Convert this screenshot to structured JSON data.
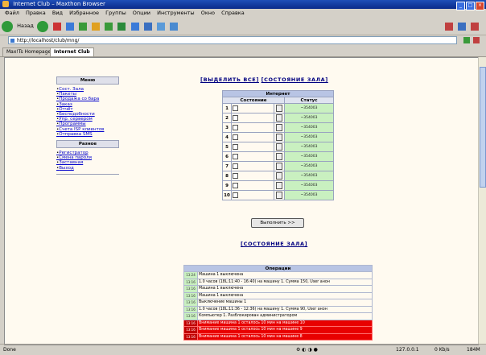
{
  "window": {
    "title": "Internet Club – Maxthon Browser"
  },
  "menu": [
    "Файл",
    "Правка",
    "Вид",
    "Избранное",
    "Группы",
    "Опции",
    "Инструменты",
    "Окно",
    "Справка"
  ],
  "toolbar": {
    "back": "Назад"
  },
  "address": {
    "url": "http://localhost/club/mng/"
  },
  "tabs": [
    {
      "label": "Max!Ts Homepage"
    },
    {
      "label": "Internet Club"
    }
  ],
  "sidebar": {
    "menu_title": "Меню",
    "menu_items": [
      "Сост. Зала",
      "Пакеты",
      "Продажа со бара",
      "Заказ",
      "Отчёт",
      "Бесподобности",
      "Упр. сервером",
      "Программы",
      "Счета ISP клиентов",
      "Отправка SMS"
    ],
    "misc_title": "Разное",
    "misc_items": [
      "Регистратор",
      "Смена пароля",
      "Заставная",
      "Выход"
    ]
  },
  "links": {
    "select_all": "[ВЫДЕЛИТЬ ВСЕ]",
    "hall_state": "[СОСТОЯНИЕ ЗАЛА]"
  },
  "internet": {
    "caption": "Интернет",
    "col_state": "Состояние",
    "col_status": "Статус",
    "rows": [
      {
        "n": "1",
        "status": "~354003"
      },
      {
        "n": "2",
        "status": "~354003"
      },
      {
        "n": "3",
        "status": "~354003"
      },
      {
        "n": "4",
        "status": "~354003"
      },
      {
        "n": "5",
        "status": "~354003"
      },
      {
        "n": "6",
        "status": "~354003"
      },
      {
        "n": "7",
        "status": "~354003"
      },
      {
        "n": "8",
        "status": "~354003"
      },
      {
        "n": "9",
        "status": "~354003"
      },
      {
        "n": "10",
        "status": "~354003"
      }
    ],
    "run_button": "Выполнить >>"
  },
  "operations": {
    "caption": "Операции",
    "rows": [
      {
        "time": "13:24",
        "text": "Машина 1 выключена",
        "alert": false
      },
      {
        "time": "13:16",
        "text": "1.0 часов (18L:11:40 - 16:40) на машину 1. Сумма 150, User анон",
        "alert": false
      },
      {
        "time": "13:16",
        "text": "Машина 1 выключена",
        "alert": false
      },
      {
        "time": "13:16",
        "text": "Машина 1 выключена",
        "alert": false
      },
      {
        "time": "13:16",
        "text": "Выключение машины 1",
        "alert": false
      },
      {
        "time": "13:16",
        "text": "1.0 часов (18L:11:36 - 12:36) на машину 1. Сумма 90, User анон",
        "alert": false
      },
      {
        "time": "13:16",
        "text": "Компьютер 1. Разблокирован администратором",
        "alert": false
      },
      {
        "time": "13:16",
        "text": "Внимание машина 1 осталось 10 мин на машине 10",
        "alert": true
      },
      {
        "time": "13:16",
        "text": "Внимание машина 1 осталось 10 мин на машине 9",
        "alert": true
      },
      {
        "time": "13:16",
        "text": "Внимание машина 1 осталось 10 мин на машине 8",
        "alert": true
      }
    ]
  },
  "status": {
    "left": "Done",
    "ip": "127.0.0.1",
    "mem": "0 Kb/s",
    "count": "184M"
  },
  "colors": {
    "accent": "#0a246a",
    "alert": "#e80000",
    "ok": "#c9f0c0"
  }
}
